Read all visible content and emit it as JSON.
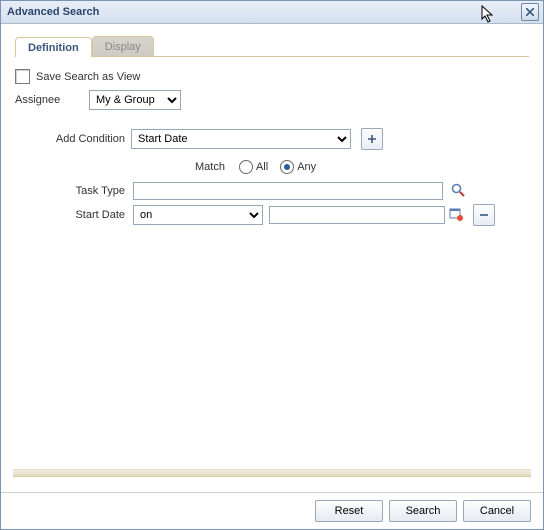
{
  "window": {
    "title": "Advanced Search"
  },
  "tabs": {
    "definition": "Definition",
    "display": "Display"
  },
  "save_view": {
    "label": "Save Search as View",
    "checked": false
  },
  "assignee": {
    "label": "Assignee",
    "value": "My & Group"
  },
  "add_condition": {
    "label": "Add Condition",
    "value": "Start Date"
  },
  "match": {
    "label": "Match",
    "all": "All",
    "any": "Any",
    "selected": "any"
  },
  "conditions": {
    "task_type": {
      "label": "Task Type",
      "value": ""
    },
    "start_date": {
      "label": "Start Date",
      "op": "on",
      "value": ""
    }
  },
  "buttons": {
    "reset": "Reset",
    "search": "Search",
    "cancel": "Cancel"
  }
}
